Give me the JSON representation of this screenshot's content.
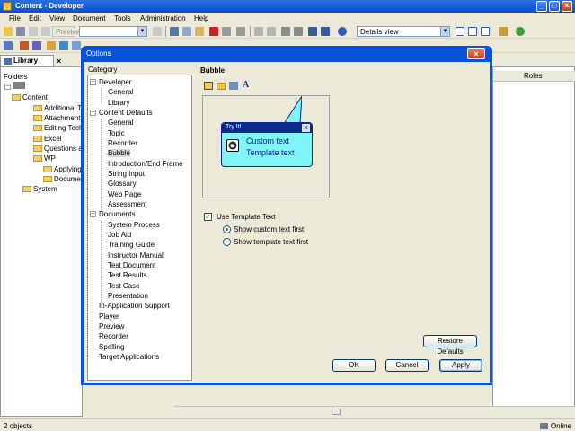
{
  "app": {
    "title": "Content - Developer"
  },
  "menu": [
    "File",
    "Edit",
    "View",
    "Document",
    "Tools",
    "Administration",
    "Help"
  ],
  "toolbar": {
    "preview_label": "Preview",
    "view_mode": "Details view"
  },
  "library": {
    "tab_label": "Library",
    "header": "Folders",
    "tree": [
      {
        "label": "Content",
        "level": 1
      },
      {
        "label": "Additional Top",
        "level": 2
      },
      {
        "label": "Attachments",
        "level": 2
      },
      {
        "label": "Editing Techn",
        "level": 2
      },
      {
        "label": "Excel",
        "level": 2
      },
      {
        "label": "Questions and",
        "level": 2
      },
      {
        "label": "WP",
        "level": 2
      },
      {
        "label": "Applying f",
        "level": 3
      },
      {
        "label": "Documen",
        "level": 3
      },
      {
        "label": "System",
        "level": 1
      }
    ]
  },
  "right_panel": {
    "col_roles": "Roles"
  },
  "status": {
    "left": "2 objects",
    "right": "Online"
  },
  "dialog": {
    "title": "Options",
    "category_label": "Category",
    "tree": [
      {
        "label": "Developer",
        "level": 0
      },
      {
        "label": "General",
        "level": 1
      },
      {
        "label": "Library",
        "level": 1
      },
      {
        "label": "Content Defaults",
        "level": 0
      },
      {
        "label": "General",
        "level": 1
      },
      {
        "label": "Topic",
        "level": 1
      },
      {
        "label": "Recorder",
        "level": 1
      },
      {
        "label": "Bubble",
        "level": 1,
        "selected": true
      },
      {
        "label": "Introduction/End Frame",
        "level": 1
      },
      {
        "label": "String Input",
        "level": 1
      },
      {
        "label": "Glossary",
        "level": 1
      },
      {
        "label": "Web Page",
        "level": 1
      },
      {
        "label": "Assessment",
        "level": 1
      },
      {
        "label": "Documents",
        "level": 0
      },
      {
        "label": "System Process",
        "level": 1
      },
      {
        "label": "Job Aid",
        "level": 1
      },
      {
        "label": "Training Guide",
        "level": 1
      },
      {
        "label": "Instructor Manual",
        "level": 1
      },
      {
        "label": "Test Document",
        "level": 1
      },
      {
        "label": "Test Results",
        "level": 1
      },
      {
        "label": "Test Case",
        "level": 1
      },
      {
        "label": "Presentation",
        "level": 1
      },
      {
        "label": "In-Application Support",
        "level": 0
      },
      {
        "label": "Player",
        "level": 0
      },
      {
        "label": "Preview",
        "level": 0
      },
      {
        "label": "Recorder",
        "level": 0
      },
      {
        "label": "Spelling",
        "level": 0
      },
      {
        "label": "Target Applications",
        "level": 0
      }
    ],
    "panel_title": "Bubble",
    "bubble": {
      "header": "Try It!",
      "line1": "Custom text",
      "line2": "Template text"
    },
    "use_template_label": "Use Template Text",
    "option_custom_first": "Show custom text first",
    "option_template_first": "Show template text first",
    "restore_label": "Restore Defaults",
    "ok_label": "OK",
    "cancel_label": "Cancel",
    "apply_label": "Apply"
  }
}
